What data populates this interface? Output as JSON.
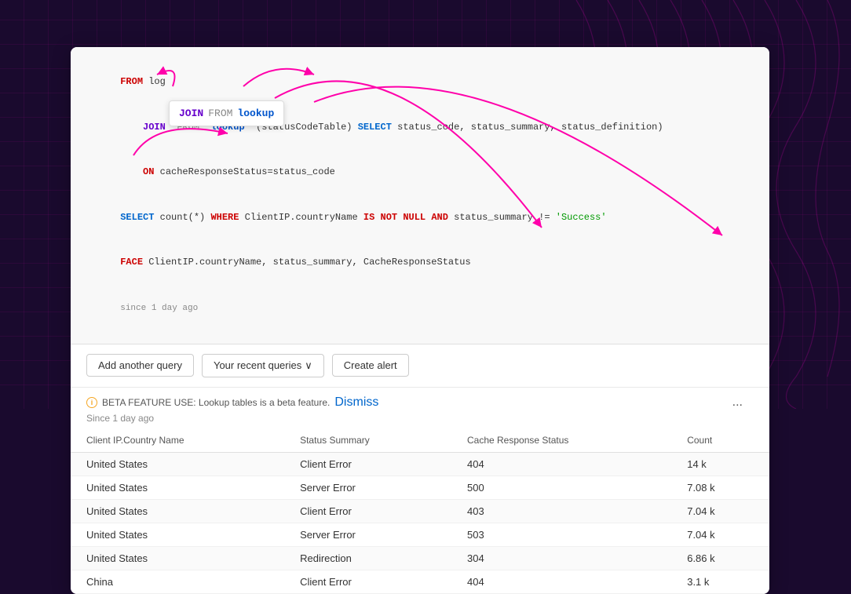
{
  "background": {
    "color": "#1a0a2e"
  },
  "code": {
    "lines": [
      "FROM log",
      "    JOIN  FROM  lookup  (statusCodeTable) SELECT status_code, status_summary, status_definition)",
      "    ON cacheResponseStatus=status_code",
      "SELECT count(*) WHERE ClientIP.countryName IS NOT NULL AND status_summary != 'Success'",
      "FACE ClientIP.countryName, status_summary, CacheResponseStatus",
      "since 1 day ago"
    ]
  },
  "tooltip": {
    "join_label": "JOIN",
    "from_label": "FROM",
    "lookup_label": "lookup"
  },
  "actions": {
    "add_query": "Add another query",
    "recent_queries": "Your recent queries",
    "chevron": "›",
    "create_alert": "Create alert"
  },
  "beta": {
    "notice": "BETA FEATURE USE: Lookup tables is a beta feature.",
    "dismiss": "Dismiss",
    "since": "Since 1 day ago"
  },
  "more_button": "...",
  "table": {
    "columns": [
      "Client IP.Country Name",
      "Status Summary",
      "Cache Response Status",
      "Count"
    ],
    "rows": [
      [
        "United States",
        "Client Error",
        "404",
        "14 k"
      ],
      [
        "United States",
        "Server Error",
        "500",
        "7.08 k"
      ],
      [
        "United States",
        "Client Error",
        "403",
        "7.04 k"
      ],
      [
        "United States",
        "Server Error",
        "503",
        "7.04 k"
      ],
      [
        "United States",
        "Redirection",
        "304",
        "6.86 k"
      ],
      [
        "China",
        "Client Error",
        "404",
        "3.1 k"
      ]
    ]
  }
}
